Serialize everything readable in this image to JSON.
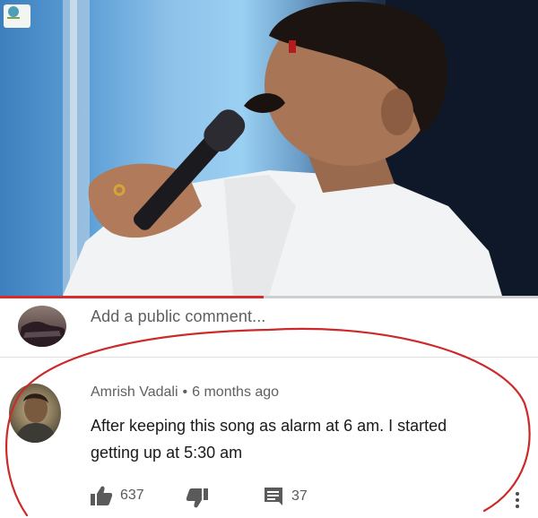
{
  "composer": {
    "placeholder": "Add a public comment..."
  },
  "comment": {
    "author": "Amrish Vadali",
    "separator": "•",
    "time": "6 months ago",
    "text": "After keeping this song as alarm at 6 am. I started getting up at 5:30 am",
    "likes": "637",
    "replies": "37"
  },
  "player": {
    "progress_fraction": 0.49
  },
  "icons": {
    "like": "thumbs-up-icon",
    "dislike": "thumbs-down-icon",
    "reply": "comment-icon",
    "more": "more-vert-icon"
  },
  "colors": {
    "progress": "#d92b2b",
    "annotation": "#cc2a2a"
  }
}
